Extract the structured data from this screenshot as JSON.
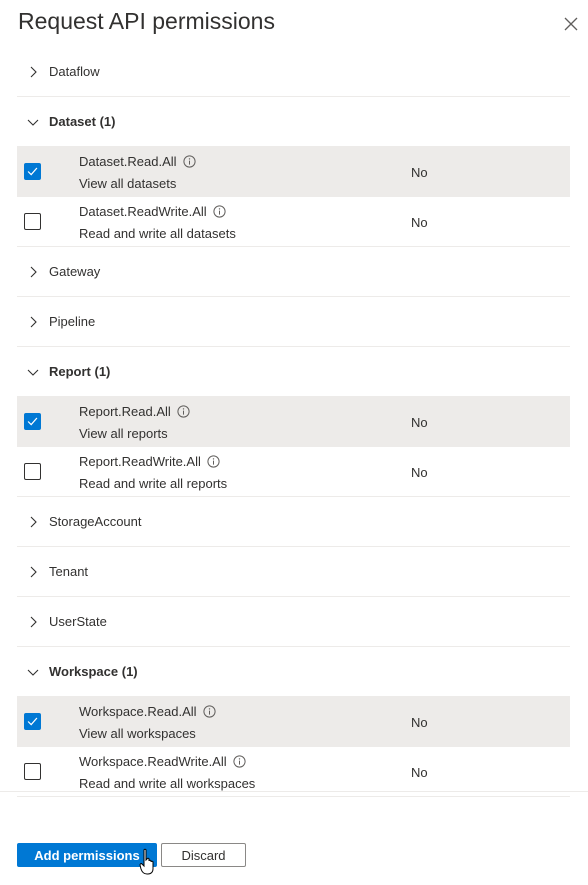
{
  "panel": {
    "title": "Request API permissions"
  },
  "groups": [
    {
      "label": "Dataflow",
      "expanded": false
    },
    {
      "label": "Dataset (1)",
      "expanded": true,
      "permissions": [
        {
          "name": "Dataset.Read.All",
          "description": "View all datasets",
          "admin_consent": "No",
          "checked": true
        },
        {
          "name": "Dataset.ReadWrite.All",
          "description": "Read and write all datasets",
          "admin_consent": "No",
          "checked": false
        }
      ]
    },
    {
      "label": "Gateway",
      "expanded": false
    },
    {
      "label": "Pipeline",
      "expanded": false
    },
    {
      "label": "Report (1)",
      "expanded": true,
      "permissions": [
        {
          "name": "Report.Read.All",
          "description": "View all reports",
          "admin_consent": "No",
          "checked": true
        },
        {
          "name": "Report.ReadWrite.All",
          "description": "Read and write all reports",
          "admin_consent": "No",
          "checked": false
        }
      ]
    },
    {
      "label": "StorageAccount",
      "expanded": false
    },
    {
      "label": "Tenant",
      "expanded": false
    },
    {
      "label": "UserState",
      "expanded": false
    },
    {
      "label": "Workspace (1)",
      "expanded": true,
      "permissions": [
        {
          "name": "Workspace.Read.All",
          "description": "View all workspaces",
          "admin_consent": "No",
          "checked": true
        },
        {
          "name": "Workspace.ReadWrite.All",
          "description": "Read and write all workspaces",
          "admin_consent": "No",
          "checked": false
        }
      ]
    }
  ],
  "footer": {
    "add_label": "Add permissions",
    "discard_label": "Discard"
  },
  "colors": {
    "accent": "#0078d4",
    "selected_row": "#edebe9",
    "divider": "#edebe9",
    "text": "#323130"
  },
  "icons": {
    "close": "close-icon",
    "chevron_collapsed": "chevron-right-icon",
    "chevron_expanded": "chevron-down-icon",
    "info": "info-icon",
    "checkbox_checked": "checkmark-icon",
    "cursor": "hand-pointer-cursor"
  }
}
